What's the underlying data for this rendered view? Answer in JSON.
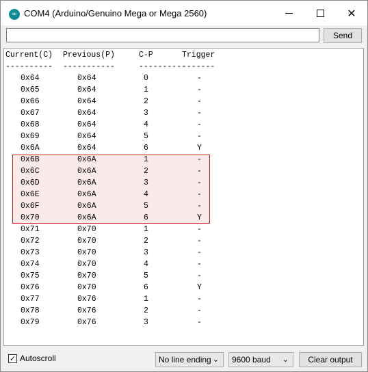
{
  "window": {
    "title": "COM4 (Arduino/Genuino Mega or Mega 2560)",
    "icon": "arduino-icon"
  },
  "toolbar": {
    "input_value": "",
    "send_label": "Send"
  },
  "output": {
    "header": [
      "Current(C)",
      "Previous(P)",
      "C-P",
      "Trigger"
    ],
    "separators": [
      "----------",
      "-----------",
      "----------",
      "-------"
    ],
    "rows": [
      [
        "0x64",
        "0x64",
        "0",
        "-"
      ],
      [
        "0x65",
        "0x64",
        "1",
        "-"
      ],
      [
        "0x66",
        "0x64",
        "2",
        "-"
      ],
      [
        "0x67",
        "0x64",
        "3",
        "-"
      ],
      [
        "0x68",
        "0x64",
        "4",
        "-"
      ],
      [
        "0x69",
        "0x64",
        "5",
        "-"
      ],
      [
        "0x6A",
        "0x64",
        "6",
        "Y"
      ],
      [
        "0x6B",
        "0x6A",
        "1",
        "-"
      ],
      [
        "0x6C",
        "0x6A",
        "2",
        "-"
      ],
      [
        "0x6D",
        "0x6A",
        "3",
        "-"
      ],
      [
        "0x6E",
        "0x6A",
        "4",
        "-"
      ],
      [
        "0x6F",
        "0x6A",
        "5",
        "-"
      ],
      [
        "0x70",
        "0x6A",
        "6",
        "Y"
      ],
      [
        "0x71",
        "0x70",
        "1",
        "-"
      ],
      [
        "0x72",
        "0x70",
        "2",
        "-"
      ],
      [
        "0x73",
        "0x70",
        "3",
        "-"
      ],
      [
        "0x74",
        "0x70",
        "4",
        "-"
      ],
      [
        "0x75",
        "0x70",
        "5",
        "-"
      ],
      [
        "0x76",
        "0x70",
        "6",
        "Y"
      ],
      [
        "0x77",
        "0x76",
        "1",
        "-"
      ],
      [
        "0x78",
        "0x76",
        "2",
        "-"
      ],
      [
        "0x79",
        "0x76",
        "3",
        "-"
      ]
    ],
    "highlight_color": "#cc1f1f"
  },
  "bottom": {
    "autoscroll_label": "Autoscroll",
    "autoscroll_checked": true,
    "line_ending": "No line ending",
    "baud": "9600 baud",
    "clear_label": "Clear output"
  }
}
